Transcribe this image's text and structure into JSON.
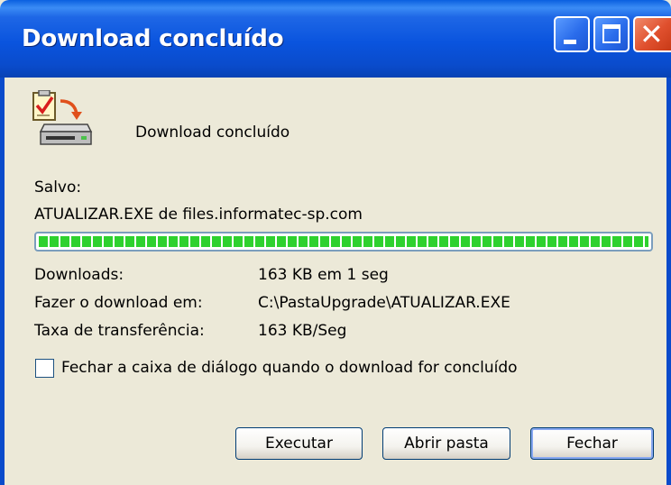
{
  "window": {
    "title": "Download concluído",
    "controls": [
      "minimize-icon",
      "maximize-icon",
      "close-icon"
    ]
  },
  "header": {
    "message": "Download concluído",
    "icon": "download-complete-icon"
  },
  "saved": {
    "label": "Salvo:",
    "source": "ATUALIZAR.EXE de files.informatec-sp.com"
  },
  "progress": {
    "value": 1.0,
    "color": "#2ED12E"
  },
  "details": [
    {
      "label": "Downloads:",
      "value": "163 KB em 1 seg"
    },
    {
      "label": "Fazer o download em:",
      "value": "C:\\PastaUpgrade\\ATUALIZAR.EXE"
    },
    {
      "label": "Taxa de transferência:",
      "value": "163 KB/Seg"
    }
  ],
  "close_on_complete": {
    "label": "Fechar a caixa de diálogo quando o download for concluído",
    "checked": false
  },
  "buttons": {
    "run": "Executar",
    "open_folder": "Abrir pasta",
    "close": "Fechar"
  },
  "colors": {
    "titlebar": "#0A54DE",
    "background": "#ECE9D8",
    "close_button": "#E0502E"
  }
}
